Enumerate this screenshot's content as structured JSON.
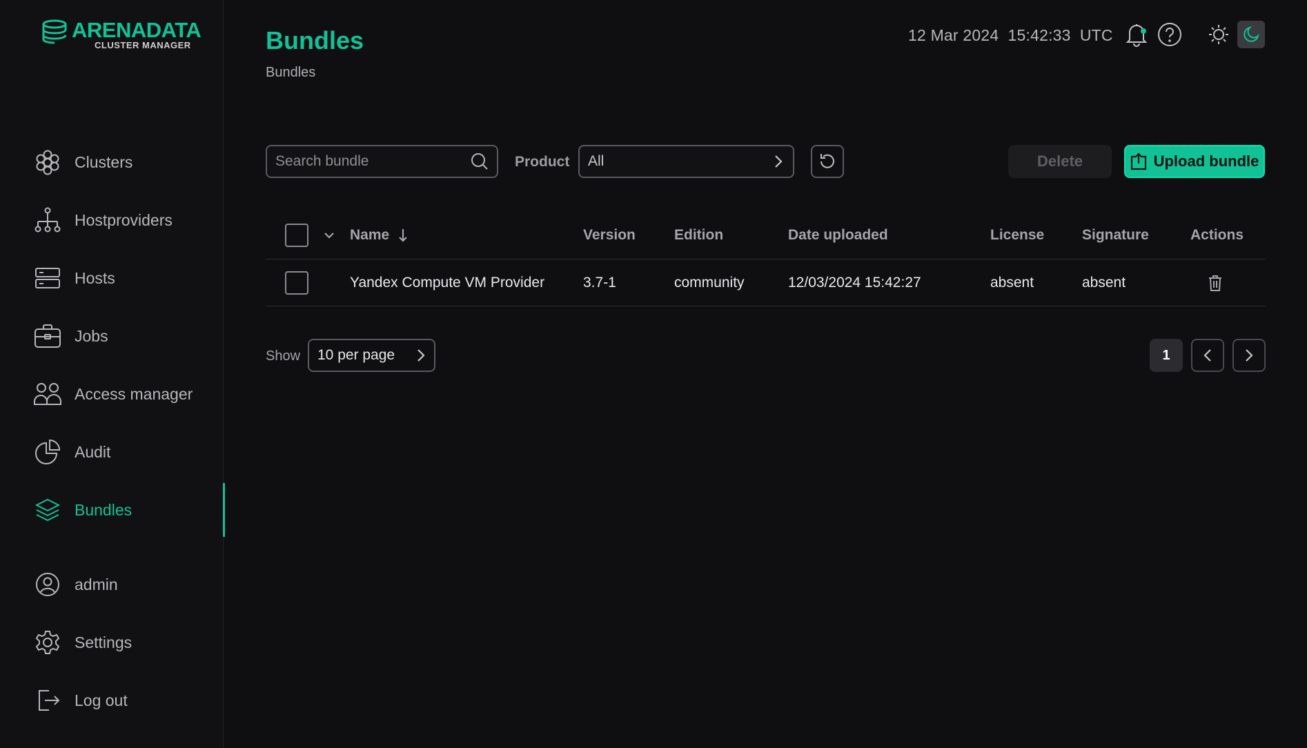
{
  "logo": {
    "title": "ARENADATA",
    "subtitle": "CLUSTER MANAGER"
  },
  "sidebar": {
    "items": [
      {
        "label": "Clusters",
        "icon": "clusters-icon"
      },
      {
        "label": "Hostproviders",
        "icon": "hostproviders-icon"
      },
      {
        "label": "Hosts",
        "icon": "hosts-icon"
      },
      {
        "label": "Jobs",
        "icon": "jobs-icon"
      },
      {
        "label": "Access manager",
        "icon": "access-manager-icon"
      },
      {
        "label": "Audit",
        "icon": "audit-icon"
      },
      {
        "label": "Bundles",
        "icon": "bundles-icon",
        "active": true
      },
      {
        "label": "admin",
        "icon": "user-icon"
      },
      {
        "label": "Settings",
        "icon": "gear-icon"
      },
      {
        "label": "Log out",
        "icon": "logout-icon"
      }
    ]
  },
  "header": {
    "title": "Bundles",
    "breadcrumb": "Bundles",
    "date": "12 Mar 2024",
    "time": "15:42:33",
    "timezone": "UTC"
  },
  "toolbar": {
    "search_placeholder": "Search bundle",
    "product_label": "Product",
    "product_value": "All",
    "delete_label": "Delete",
    "upload_label": "Upload bundle"
  },
  "table": {
    "columns": {
      "name": "Name",
      "version": "Version",
      "edition": "Edition",
      "date_uploaded": "Date uploaded",
      "license": "License",
      "signature": "Signature",
      "actions": "Actions"
    },
    "rows": [
      {
        "name": "Yandex Compute VM Provider",
        "version": "3.7-1",
        "edition": "community",
        "date_uploaded": "12/03/2024 15:42:27",
        "license": "absent",
        "signature": "absent"
      }
    ]
  },
  "pagination": {
    "show_label": "Show",
    "per_page": "10 per page",
    "current_page": "1"
  },
  "colors": {
    "accent": "#12c296",
    "background": "#0f0f11",
    "sidebar": "#111113"
  }
}
